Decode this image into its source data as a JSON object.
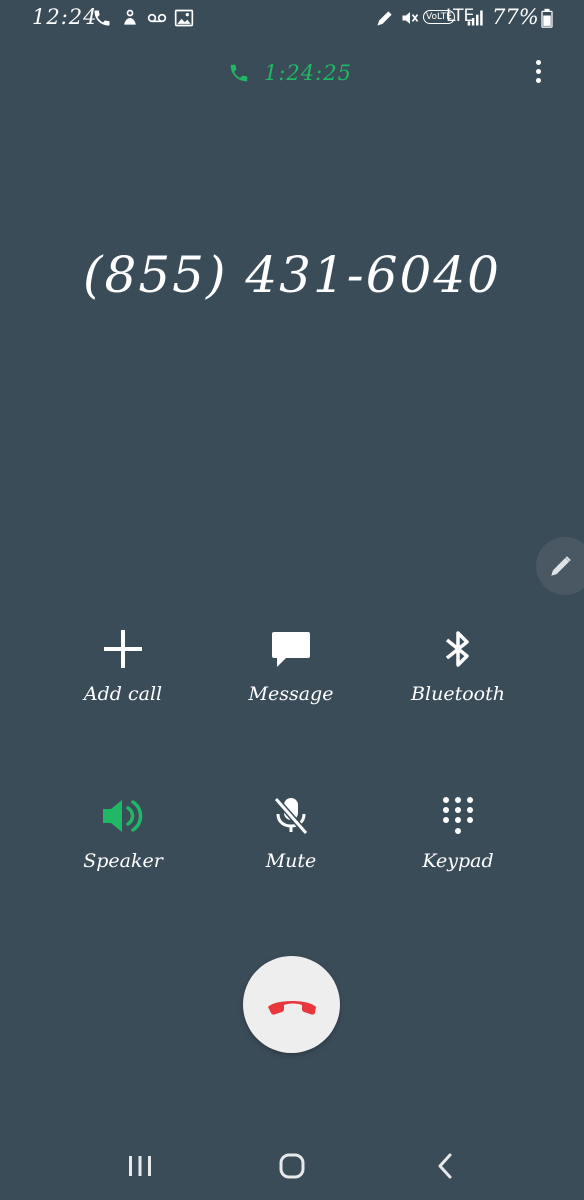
{
  "status_bar": {
    "time": "12:24",
    "network": "LTE",
    "volte": "VoLTE",
    "battery_percent": "77%",
    "left_icons": [
      "phone-call-icon",
      "assistant-icon",
      "voicemail-icon",
      "image-icon"
    ],
    "right_icons": [
      "stylus-icon",
      "vibrate-mute-icon",
      "volte-icon",
      "signal-icon",
      "battery-icon"
    ]
  },
  "call": {
    "timer": "1:24:25",
    "number": "(855) 431-6040",
    "accent_color": "#1fb865",
    "end_color": "#e8383d"
  },
  "controls": [
    {
      "label": "Add call",
      "icon": "plus-icon"
    },
    {
      "label": "Message",
      "icon": "message-icon"
    },
    {
      "label": "Bluetooth",
      "icon": "bluetooth-icon"
    },
    {
      "label": "Speaker",
      "icon": "speaker-icon",
      "active": true
    },
    {
      "label": "Mute",
      "icon": "mic-off-icon"
    },
    {
      "label": "Keypad",
      "icon": "keypad-icon"
    }
  ],
  "colors": {
    "background": "#3b4c59",
    "foreground": "#ffffff"
  }
}
